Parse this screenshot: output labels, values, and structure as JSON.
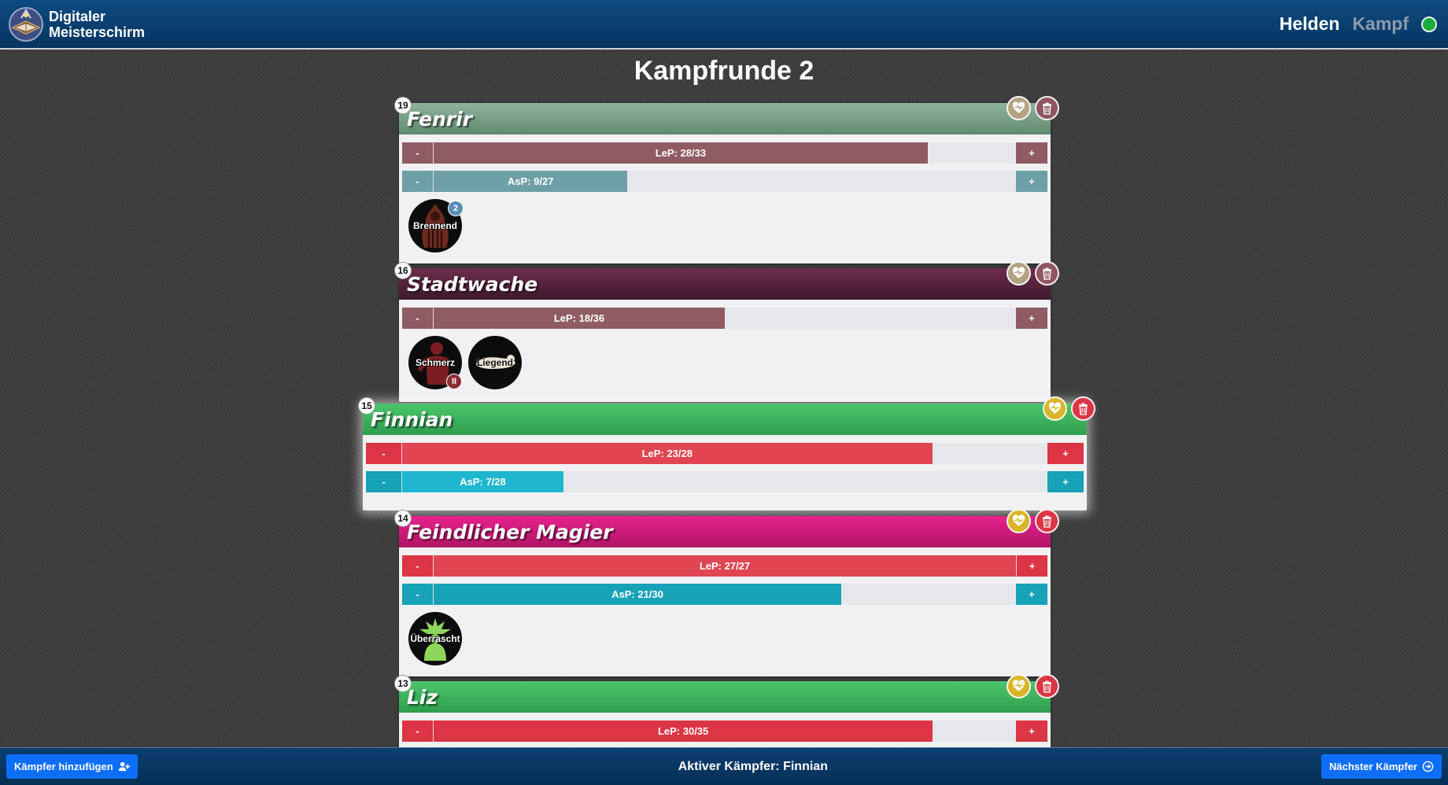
{
  "header": {
    "brand_line1": "Digitaler",
    "brand_line2": "Meisterschirm",
    "nav": [
      {
        "label": "Helden",
        "active": true
      },
      {
        "label": "Kampf",
        "active": false
      }
    ],
    "connection_status_color": "#1bab3b"
  },
  "page_title": "Kampfrunde 2",
  "colors": {
    "hp_muted": "#8f5c63",
    "hp_active": "#dc3545",
    "asp_muted": "#6e9ea6",
    "asp_active_strong": "#17a2b8",
    "asp_active": "#1fb6cf",
    "heal_muted": "#b3a283",
    "heal_active": "#d9b52a",
    "delete_muted": "#8f5560",
    "delete_active": "#dc3545"
  },
  "fighters": [
    {
      "initiative": "19",
      "name": "Fenrir",
      "lep": {
        "label": "LeP: 28/33",
        "current": 28,
        "max": 33
      },
      "asp": {
        "label": "AsP: 9/27",
        "current": 9,
        "max": 27
      },
      "conditions": [
        {
          "label": "Brennend",
          "level": "2"
        }
      ]
    },
    {
      "initiative": "16",
      "name": "Stadtwache",
      "lep": {
        "label": "LeP: 18/36",
        "current": 18,
        "max": 36
      },
      "conditions": [
        {
          "label": "Schmerz",
          "level": "II"
        },
        {
          "label": "Liegend"
        }
      ]
    },
    {
      "initiative": "15",
      "name": "Finnian",
      "active": true,
      "lep": {
        "label": "LeP: 23/28",
        "current": 23,
        "max": 28
      },
      "asp": {
        "label": "AsP: 7/28",
        "current": 7,
        "max": 28
      }
    },
    {
      "initiative": "14",
      "name": "Feindlicher Magier",
      "lep": {
        "label": "LeP: 27/27",
        "current": 27,
        "max": 27
      },
      "asp": {
        "label": "AsP: 21/30",
        "current": 21,
        "max": 30
      },
      "conditions": [
        {
          "label": "Überrascht"
        }
      ]
    },
    {
      "initiative": "13",
      "name": "Liz",
      "lep": {
        "label": "LeP: 30/35",
        "current": 30,
        "max": 35
      }
    }
  ],
  "buttons": {
    "minus": "-",
    "plus": "+"
  },
  "footer": {
    "add_fighter": "Kämpfer hinzufügen",
    "active_fighter": "Aktiver Kämpfer: Finnian",
    "next_fighter": "Nächster Kämpfer"
  }
}
